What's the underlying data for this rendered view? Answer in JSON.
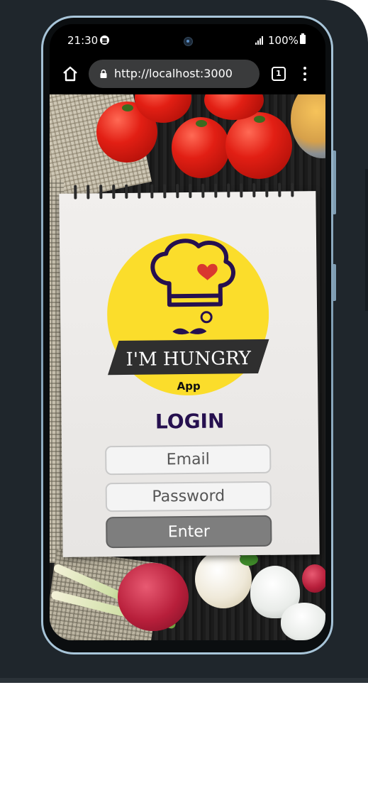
{
  "status_bar": {
    "time": "21:30",
    "battery": "100%",
    "icons": [
      "spotify-icon",
      "camera-icon",
      "signal-icon",
      "battery-icon"
    ]
  },
  "browser": {
    "url": "http://localhost:3000",
    "tab_count": "1",
    "icons": [
      "home-icon",
      "lock-icon",
      "tabs-icon",
      "menu-icon"
    ]
  },
  "logo": {
    "title": "I'M HUNGRY",
    "subtitle": "App",
    "colors": {
      "circle": "#fbdd2b",
      "banner": "#2f2f2f",
      "hat": "#26104f",
      "heart": "#d9382f"
    }
  },
  "login": {
    "title": "LOGIN",
    "email_placeholder": "Email",
    "password_placeholder": "Password",
    "submit_label": "Enter"
  },
  "colors": {
    "title": "#26104f",
    "button": "#7e7e7e",
    "field": "#f4f4f4"
  }
}
